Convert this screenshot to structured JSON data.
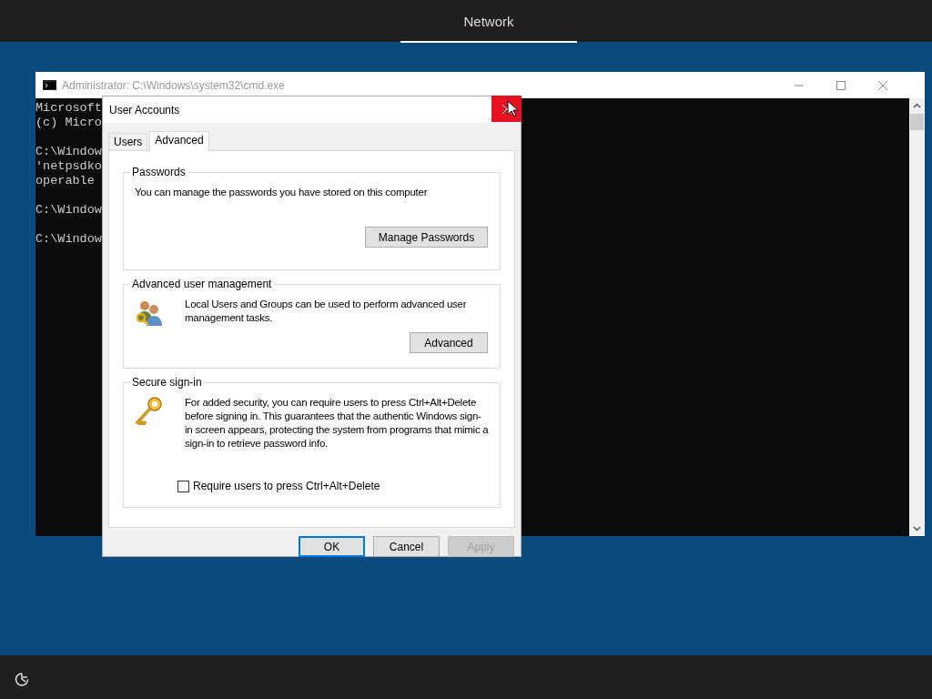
{
  "top_bar": {
    "tabs": [
      {
        "label": "Network",
        "selected": true
      }
    ]
  },
  "console_window": {
    "title": "Administrator: C:\\Windows\\system32\\cmd.exe",
    "blocks": [
      [
        "Microsoft",
        "(c) Micro"
      ],
      [
        "C:\\Window",
        "'netpsdko",
        "operable"
      ],
      [
        "C:\\Window"
      ],
      [
        "C:\\Window"
      ]
    ]
  },
  "dialog": {
    "title": "User Accounts",
    "tabs": [
      {
        "label": "Users",
        "selected": false
      },
      {
        "label": "Advanced",
        "selected": true
      }
    ],
    "groups": [
      {
        "title": "Passwords",
        "text": "You can manage the passwords you have stored on this computer",
        "button": "Manage Passwords"
      },
      {
        "title": "Advanced user management",
        "text": "Local Users and Groups can be used to perform advanced user management tasks.",
        "button": "Advanced"
      },
      {
        "title": "Secure sign-in",
        "text": "For added security, you can require users to press Ctrl+Alt+Delete before signing in. This guarantees that the authentic Windows sign-in screen appears, protecting the system from programs that mimic a sign-in to retrieve password info.",
        "checkbox": {
          "label": "Require users to press Ctrl+Alt+Delete",
          "checked": false
        }
      }
    ],
    "buttons": [
      {
        "label": "OK",
        "default": true,
        "disabled": false
      },
      {
        "label": "Cancel",
        "default": false,
        "disabled": false
      },
      {
        "label": "Apply",
        "default": false,
        "disabled": true
      }
    ]
  }
}
